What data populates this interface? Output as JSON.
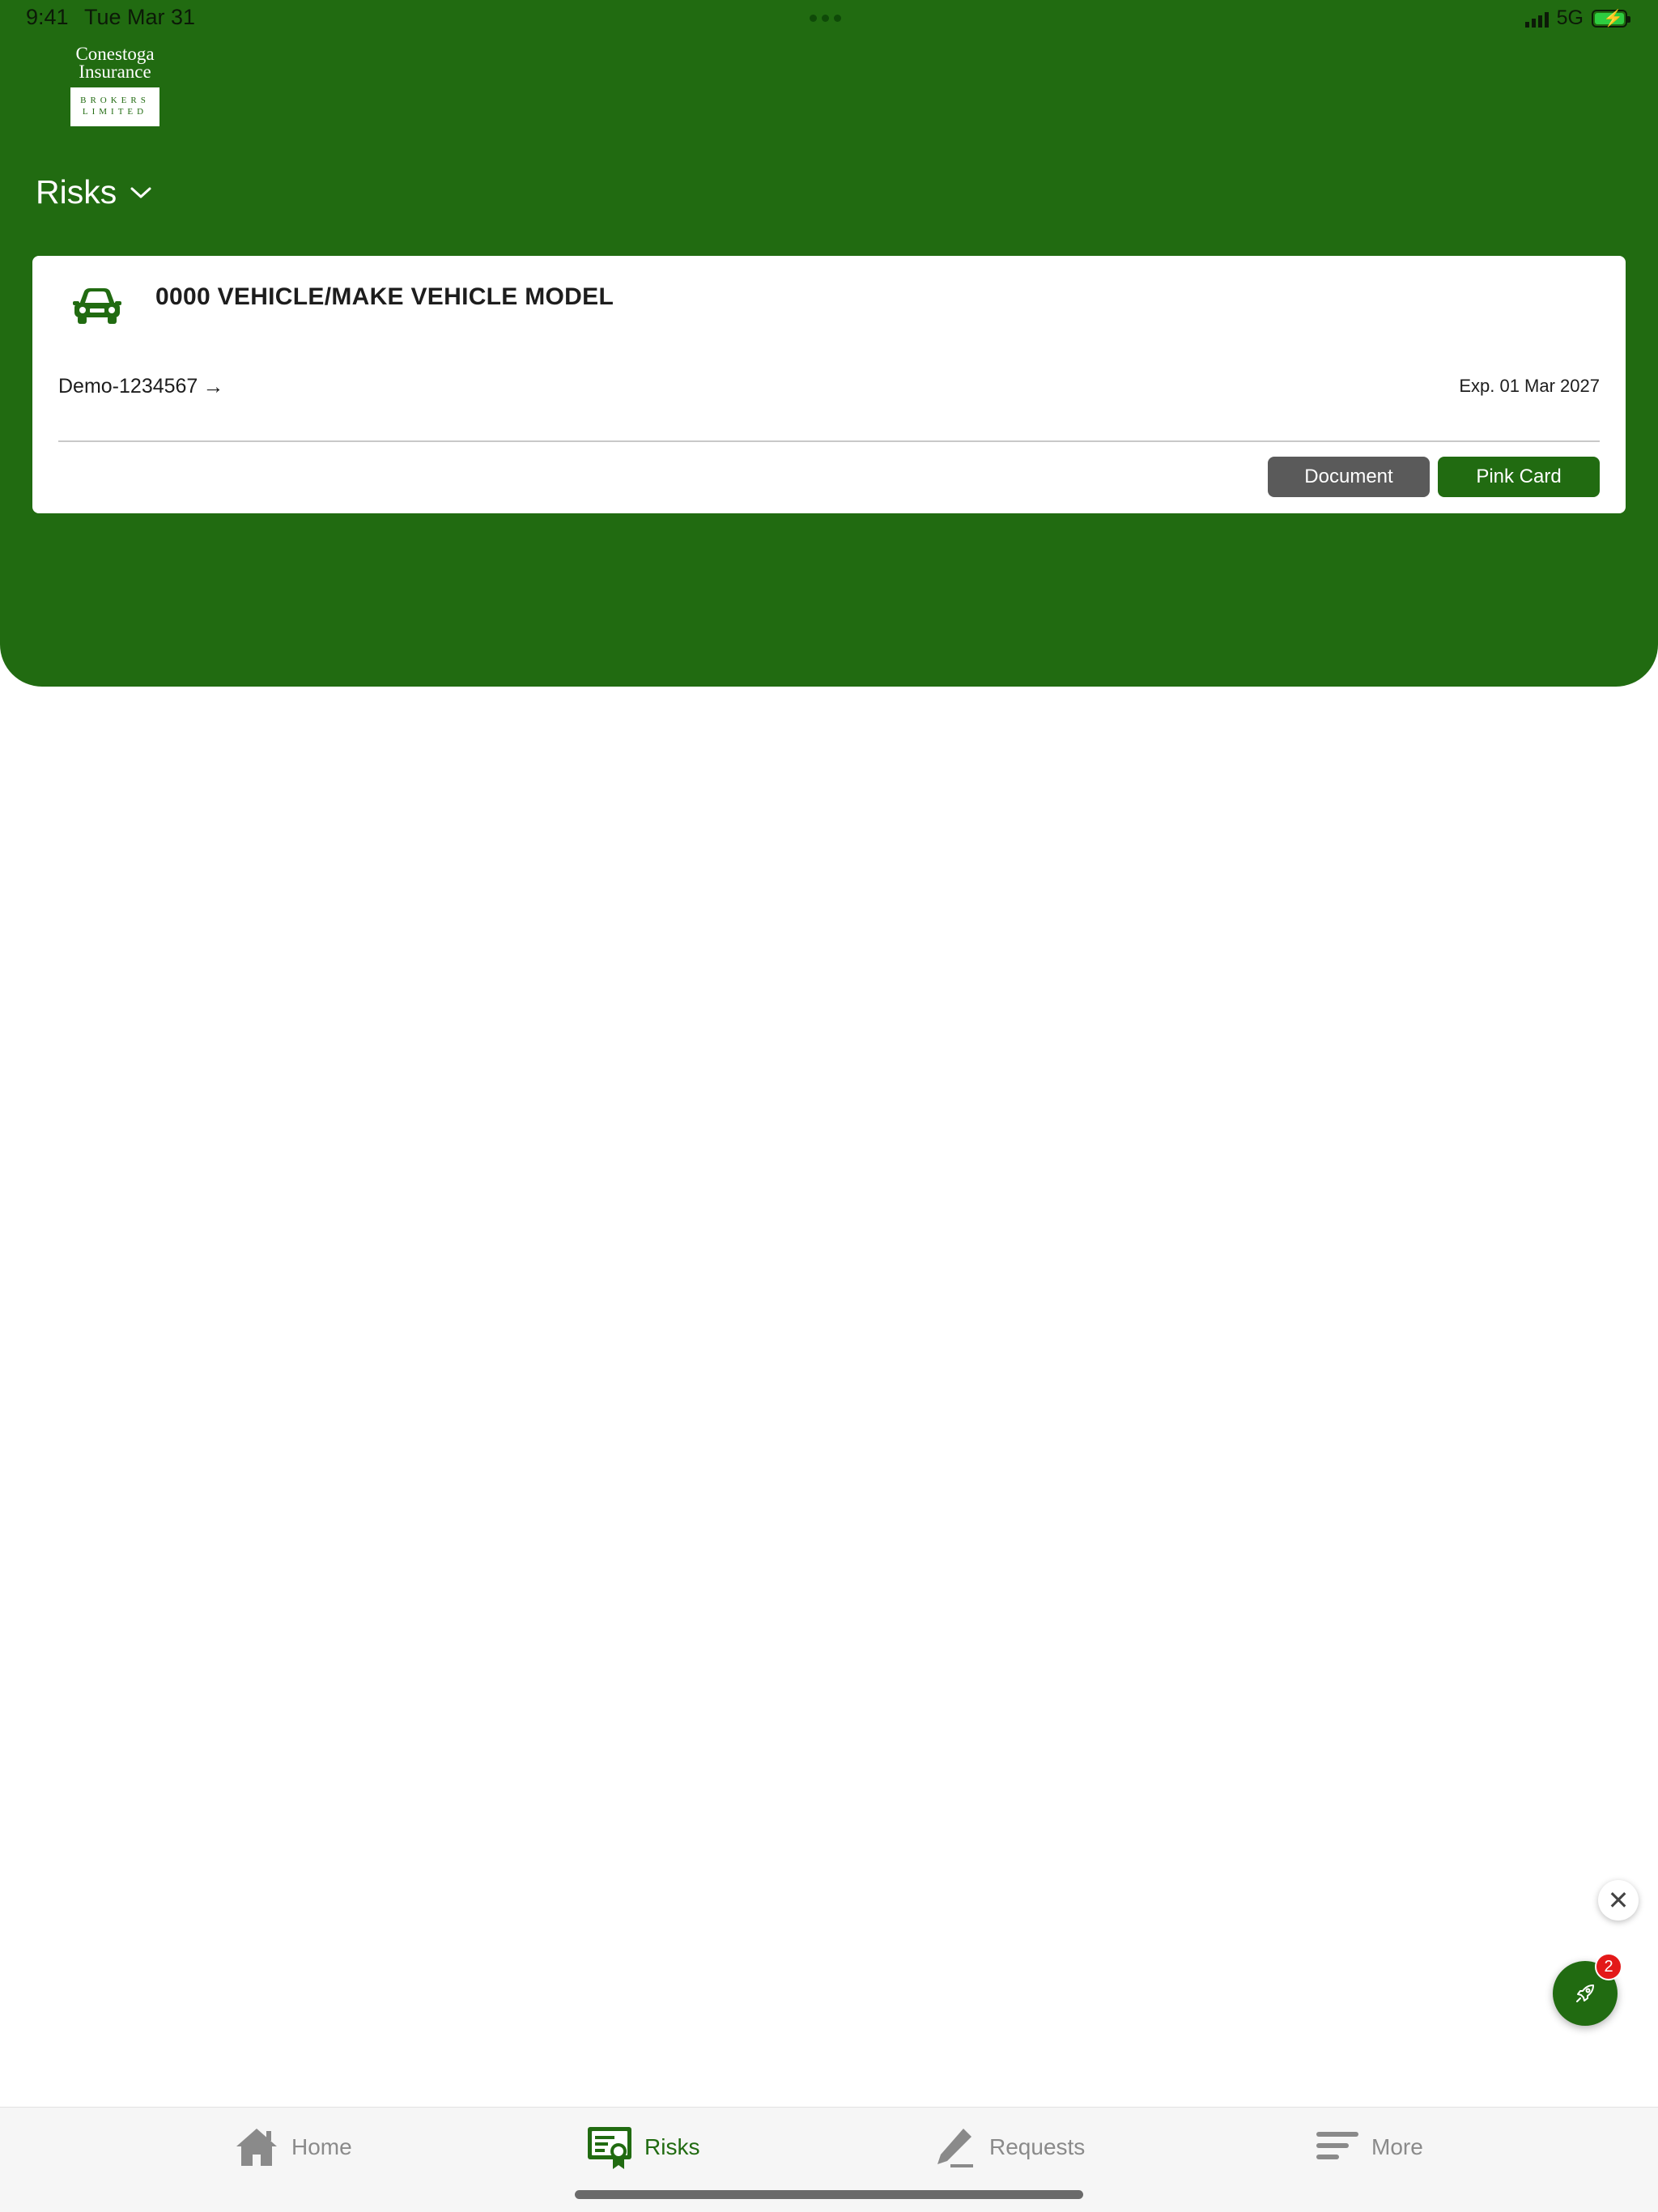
{
  "status_bar": {
    "time": "9:41",
    "date": "Tue Mar 31",
    "network": "5G"
  },
  "brand": {
    "name_line1": "Conestoga",
    "name_line2": "Insurance",
    "sub_line1": "BROKERS",
    "sub_line2": "LIMITED",
    "primary_color": "#216b11"
  },
  "section": {
    "title": "Risks",
    "dropdown_icon": "chevron-down-icon"
  },
  "risk_card": {
    "icon": "car-icon",
    "title": "0000 VEHICLE/MAKE VEHICLE MODEL",
    "policy_number": "Demo-1234567",
    "policy_arrow": "→",
    "expiry": "Exp. 01 Mar 2027",
    "document_button": "Document",
    "pink_card_button": "Pink Card",
    "document_button_color": "#5a5a5a"
  },
  "floating": {
    "close_symbol": "✕",
    "launcher_icon": "rocket-icon",
    "badge_count": "2",
    "badge_color": "#e31919"
  },
  "tabs": [
    {
      "label": "Home",
      "icon": "home-icon",
      "active": false
    },
    {
      "label": "Risks",
      "icon": "certificate-icon",
      "active": true
    },
    {
      "label": "Requests",
      "icon": "pencil-icon",
      "active": false
    },
    {
      "label": "More",
      "icon": "menu-lines-icon",
      "active": false
    }
  ]
}
